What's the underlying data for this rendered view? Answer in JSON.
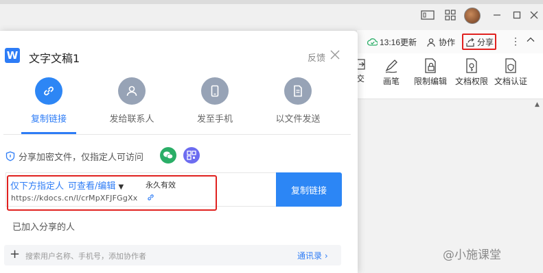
{
  "titlebar": {
    "icons": [
      "window-switch-icon",
      "grid-apps-icon",
      "avatar",
      "minimize-icon",
      "maximize-icon",
      "close-icon"
    ],
    "window_switch_label": "1"
  },
  "doc_header": {
    "update_time": "13:16更新",
    "collaborate": "协作",
    "share": "分享"
  },
  "ribbon": {
    "items": [
      {
        "label": "画笔",
        "icon": "pen-icon"
      },
      {
        "label": "限制编辑",
        "icon": "lock-doc-icon"
      },
      {
        "label": "文档权限",
        "icon": "key-doc-icon"
      },
      {
        "label": "文档认证",
        "icon": "shield-doc-icon"
      }
    ],
    "partial_label": "交"
  },
  "panel": {
    "title": "文字文稿1",
    "app_icon": "W",
    "feedback": "反馈",
    "options": [
      {
        "label": "复制链接",
        "icon": "link-icon",
        "active": true
      },
      {
        "label": "发给联系人",
        "icon": "person-icon",
        "active": false
      },
      {
        "label": "发至手机",
        "icon": "phone-icon",
        "active": false
      },
      {
        "label": "以文件发送",
        "icon": "file-icon",
        "active": false
      }
    ],
    "encrypt_text": "分享加密文件，仅指定人可访问",
    "link": {
      "scope": "仅下方指定人",
      "permission": "可查看/编辑",
      "expire": "永久有效",
      "url": "https://kdocs.cn/l/crMpXFJFGgXx"
    },
    "copy_button": "复制链接",
    "added_label": "已加入分享的人",
    "search_placeholder": "搜索用户名称、手机号，添加协作者",
    "contacts_link": "通讯录"
  },
  "watermark": "@小施课堂",
  "colors": {
    "accent": "#2d7cf6",
    "highlight": "#e0201e",
    "wechat": "#2aae67",
    "qr": "#6c6cf0"
  }
}
